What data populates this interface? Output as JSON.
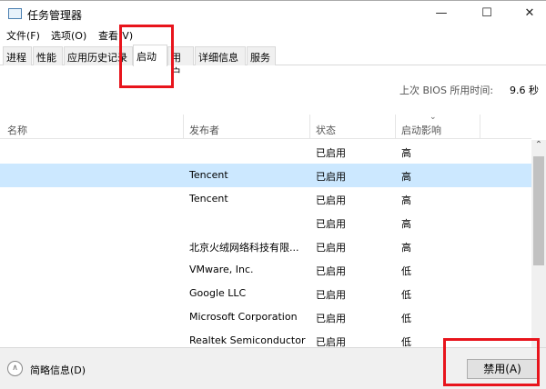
{
  "window": {
    "title": "任务管理器",
    "minimize": "—",
    "maximize": "☐",
    "close": "✕"
  },
  "menu": [
    "文件(F)",
    "选项(O)",
    "查看(V)"
  ],
  "tabs": [
    "进程",
    "性能",
    "应用历史记录",
    "启动",
    "用户",
    "详细信息",
    "服务"
  ],
  "active_tab": "启动",
  "bios": {
    "label": "上次 BIOS 所用时间:",
    "value": "9.6 秒"
  },
  "columns": {
    "name": "名称",
    "publisher": "发布者",
    "status": "状态",
    "impact": "启动影响"
  },
  "rows": [
    {
      "name": "",
      "publisher": "",
      "status": "已启用",
      "impact": "高"
    },
    {
      "name": "",
      "publisher": "Tencent",
      "status": "已启用",
      "impact": "高",
      "selected": true
    },
    {
      "name": "",
      "publisher": "Tencent",
      "status": "已启用",
      "impact": "高"
    },
    {
      "name": "",
      "publisher": "",
      "status": "已启用",
      "impact": "高"
    },
    {
      "name": "",
      "publisher": "北京火绒网络科技有限...",
      "status": "已启用",
      "impact": "高"
    },
    {
      "name": "",
      "publisher": "VMware, Inc.",
      "status": "已启用",
      "impact": "低"
    },
    {
      "name": "",
      "publisher": "Google LLC",
      "status": "已启用",
      "impact": "低"
    },
    {
      "name": "",
      "publisher": "Microsoft Corporation",
      "status": "已启用",
      "impact": "低"
    },
    {
      "name": "",
      "publisher": "Realtek Semiconductor",
      "status": "已启用",
      "impact": "低"
    }
  ],
  "footer": {
    "fewer_details": "简略信息(D)",
    "disable": "禁用(A)"
  },
  "colors": {
    "selected_row": "#cce8ff",
    "highlight": "#e8141c"
  }
}
